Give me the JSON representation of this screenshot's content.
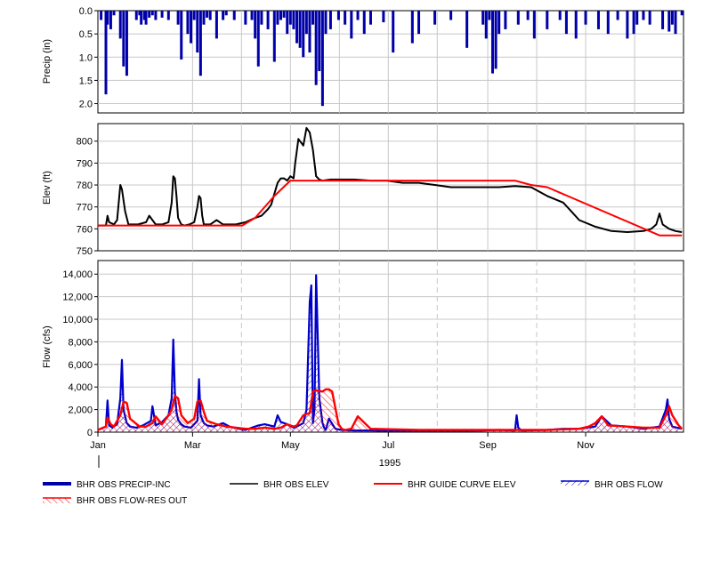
{
  "chart_data": [
    {
      "type": "bar",
      "panel": "precip",
      "ylabel": "Precip (in)",
      "ylim": [
        0,
        2.2
      ],
      "inverted_y": true,
      "yticks": [
        "0.0",
        "0.5",
        "1.0",
        "1.5",
        "2.0"
      ],
      "ytick_values": [
        0,
        0.5,
        1.0,
        1.5,
        2.0
      ],
      "grid": true,
      "series": [
        {
          "name": "BHR OBS PRECIP-INC",
          "color": "#0000aa",
          "x": [
            2,
            5,
            6,
            8,
            10,
            14,
            16,
            18,
            24,
            26,
            27,
            29,
            30,
            32,
            34,
            36,
            40,
            44,
            50,
            52,
            56,
            58,
            60,
            62,
            64,
            66,
            68,
            70,
            74,
            78,
            80,
            85,
            92,
            96,
            98,
            100,
            102,
            106,
            110,
            112,
            114,
            116,
            118,
            120,
            122,
            124,
            126,
            128,
            130,
            132,
            134,
            136,
            138,
            140,
            142,
            145,
            150,
            154,
            158,
            162,
            166,
            170,
            178,
            184,
            196,
            200,
            210,
            220,
            230,
            240,
            242,
            244,
            246,
            248,
            250,
            254,
            262,
            268,
            272,
            280,
            288,
            292,
            298,
            304,
            312,
            318,
            324,
            330,
            334,
            336,
            340,
            344,
            352,
            356,
            358,
            360,
            364
          ],
          "values": [
            0.2,
            1.8,
            0.3,
            0.4,
            0.1,
            0.6,
            1.2,
            1.4,
            0.2,
            0.1,
            0.3,
            0.2,
            0.3,
            0.15,
            0.1,
            0.2,
            0.15,
            0.2,
            0.3,
            1.05,
            0.5,
            0.7,
            0.2,
            0.9,
            1.4,
            0.3,
            0.15,
            0.2,
            0.6,
            0.2,
            0.1,
            0.2,
            0.3,
            0.2,
            0.6,
            1.2,
            0.3,
            0.4,
            1.1,
            0.3,
            0.2,
            0.15,
            0.5,
            0.3,
            0.4,
            0.7,
            0.8,
            1.0,
            0.5,
            0.9,
            0.3,
            1.6,
            1.3,
            2.05,
            0.5,
            0.4,
            0.2,
            0.3,
            0.6,
            0.2,
            0.5,
            0.3,
            0.25,
            0.9,
            0.7,
            0.5,
            0.3,
            0.2,
            0.8,
            0.3,
            0.6,
            0.2,
            1.35,
            1.25,
            0.5,
            0.4,
            0.3,
            0.2,
            0.6,
            0.4,
            0.2,
            0.5,
            0.6,
            0.3,
            0.4,
            0.5,
            0.2,
            0.6,
            0.5,
            0.3,
            0.2,
            0.3,
            0.4,
            0.45,
            0.3,
            0.5,
            0.1
          ]
        }
      ]
    },
    {
      "type": "line",
      "panel": "elev",
      "ylabel": "Elev (ft)",
      "ylim": [
        750,
        808
      ],
      "yticks": [
        "750",
        "760",
        "770",
        "780",
        "790",
        "800"
      ],
      "ytick_values": [
        750,
        760,
        770,
        780,
        790,
        800
      ],
      "grid": true,
      "series": [
        {
          "name": "BHR OBS ELEV",
          "color": "#000000",
          "x": [
            0,
            5,
            6,
            7,
            10,
            12,
            13,
            14,
            15,
            17,
            19,
            22,
            25,
            30,
            32,
            34,
            36,
            40,
            44,
            46,
            47,
            48,
            49,
            50,
            52,
            54,
            57,
            60,
            62,
            63,
            64,
            65,
            66,
            68,
            70,
            72,
            74,
            76,
            78,
            82,
            86,
            92,
            98,
            102,
            106,
            108,
            110,
            112,
            114,
            116,
            118,
            120,
            122,
            123,
            125,
            128,
            130,
            132,
            134,
            136,
            138,
            140,
            145,
            150,
            160,
            170,
            180,
            190,
            200,
            210,
            220,
            230,
            240,
            250,
            260,
            270,
            280,
            290,
            295,
            300,
            310,
            320,
            330,
            340,
            345,
            348,
            350,
            352,
            356,
            360,
            364
          ],
          "values": [
            761.5,
            761.5,
            766,
            763,
            762,
            764,
            772,
            780,
            778,
            768,
            762,
            762,
            762,
            763,
            766,
            764,
            762,
            762,
            763,
            772,
            784,
            783,
            775,
            765,
            762,
            761.5,
            762,
            763,
            770,
            775,
            774,
            766,
            762,
            762,
            762,
            763,
            764,
            763,
            762,
            762,
            762,
            763,
            765,
            766,
            769,
            771,
            776,
            781,
            783,
            783,
            782,
            784,
            783,
            790,
            801,
            798,
            806,
            804,
            796,
            784,
            782.5,
            782,
            782.5,
            782.5,
            782.5,
            782,
            782,
            781,
            781,
            780,
            779,
            779,
            779,
            779,
            779.5,
            779,
            775,
            772,
            768,
            764,
            761,
            759,
            758.5,
            759,
            760,
            762,
            767,
            762,
            760,
            759,
            758.5
          ]
        },
        {
          "name": "BHR GUIDE CURVE ELEV",
          "color": "#ff0000",
          "x": [
            0,
            90,
            98,
            110,
            120,
            135,
            200,
            260,
            270,
            280,
            350,
            364
          ],
          "values": [
            761.5,
            761.5,
            765,
            775,
            782,
            782,
            782,
            782,
            780,
            779,
            757,
            757
          ]
        }
      ]
    },
    {
      "type": "area",
      "panel": "flow",
      "ylabel": "Flow (cfs)",
      "ylim": [
        0,
        15200
      ],
      "yticks": [
        "0",
        "2,000",
        "4,000",
        "6,000",
        "8,000",
        "10,000",
        "12,000",
        "14,000"
      ],
      "ytick_values": [
        0,
        2000,
        4000,
        6000,
        8000,
        10000,
        12000,
        14000
      ],
      "grid": true,
      "xlabel": "1995",
      "x_ticks": [
        "Jan",
        "Mar",
        "May",
        "Jul",
        "Sep",
        "Nov"
      ],
      "x_tick_values": [
        0,
        59,
        120,
        181,
        243,
        304
      ],
      "xlim": [
        0,
        365
      ],
      "series": [
        {
          "name": "BHR OBS FLOW",
          "color": "#0000cc",
          "x": [
            0,
            5,
            6,
            7,
            9,
            12,
            14,
            15,
            16,
            18,
            20,
            24,
            28,
            33,
            34,
            36,
            40,
            44,
            46,
            47,
            48,
            49,
            50,
            52,
            54,
            58,
            62,
            63,
            64,
            66,
            68,
            72,
            78,
            82,
            88,
            92,
            96,
            100,
            104,
            110,
            112,
            114,
            118,
            122,
            124,
            128,
            130,
            132,
            133,
            134,
            135,
            136,
            138,
            140,
            141,
            142,
            144,
            148,
            152,
            160,
            170,
            180,
            200,
            220,
            240,
            250,
            260,
            261,
            262,
            264,
            280,
            290,
            300,
            310,
            314,
            320,
            330,
            340,
            350,
            354,
            355,
            356,
            358,
            364
          ],
          "values": [
            200,
            500,
            2800,
            600,
            400,
            700,
            3000,
            6400,
            2000,
            800,
            500,
            400,
            600,
            1000,
            2300,
            600,
            900,
            1500,
            3000,
            8200,
            3500,
            1800,
            1100,
            700,
            500,
            400,
            1000,
            4700,
            1500,
            800,
            600,
            500,
            800,
            500,
            300,
            200,
            400,
            600,
            700,
            500,
            1500,
            900,
            700,
            400,
            500,
            800,
            2000,
            11500,
            13000,
            800,
            2000,
            13900,
            3000,
            800,
            400,
            200,
            1200,
            300,
            200,
            150,
            150,
            100,
            100,
            100,
            150,
            200,
            150,
            1500,
            400,
            150,
            200,
            300,
            300,
            500,
            1400,
            600,
            500,
            300,
            500,
            2000,
            2900,
            1200,
            500,
            300
          ]
        },
        {
          "name": "BHR OBS FLOW-RES OUT",
          "color": "#ff0000",
          "x": [
            0,
            5,
            6,
            8,
            10,
            14,
            16,
            18,
            20,
            26,
            30,
            34,
            36,
            40,
            44,
            46,
            48,
            50,
            52,
            56,
            60,
            62,
            64,
            66,
            68,
            74,
            80,
            86,
            92,
            98,
            104,
            110,
            114,
            118,
            122,
            124,
            128,
            132,
            134,
            136,
            140,
            142,
            144,
            146,
            150,
            152,
            154,
            158,
            162,
            170,
            200,
            240,
            260,
            280,
            300,
            306,
            310,
            314,
            318,
            330,
            340,
            350,
            354,
            356,
            358,
            362,
            364
          ],
          "values": [
            200,
            500,
            1300,
            700,
            500,
            1500,
            2700,
            2600,
            1200,
            500,
            500,
            800,
            1400,
            700,
            1500,
            2000,
            3200,
            3000,
            1500,
            800,
            1200,
            2700,
            2800,
            1800,
            1000,
            700,
            500,
            400,
            300,
            300,
            400,
            300,
            400,
            700,
            500,
            600,
            1500,
            1700,
            3600,
            3700,
            3600,
            3800,
            3800,
            3600,
            700,
            300,
            200,
            300,
            1400,
            300,
            200,
            200,
            200,
            200,
            300,
            500,
            800,
            1400,
            600,
            500,
            400,
            400,
            1500,
            2300,
            1500,
            600,
            300
          ]
        }
      ]
    }
  ],
  "legend": [
    {
      "label": "BHR OBS PRECIP-INC",
      "color": "#0000aa",
      "style": "thick"
    },
    {
      "label": "BHR OBS ELEV",
      "color": "#000000",
      "style": "line"
    },
    {
      "label": "BHR GUIDE CURVE ELEV",
      "color": "#ff0000",
      "style": "line"
    },
    {
      "label": "BHR OBS FLOW",
      "color": "#0000cc",
      "style": "hatch"
    },
    {
      "label": "BHR OBS FLOW-RES OUT",
      "color": "#ff0000",
      "style": "hatch"
    }
  ]
}
